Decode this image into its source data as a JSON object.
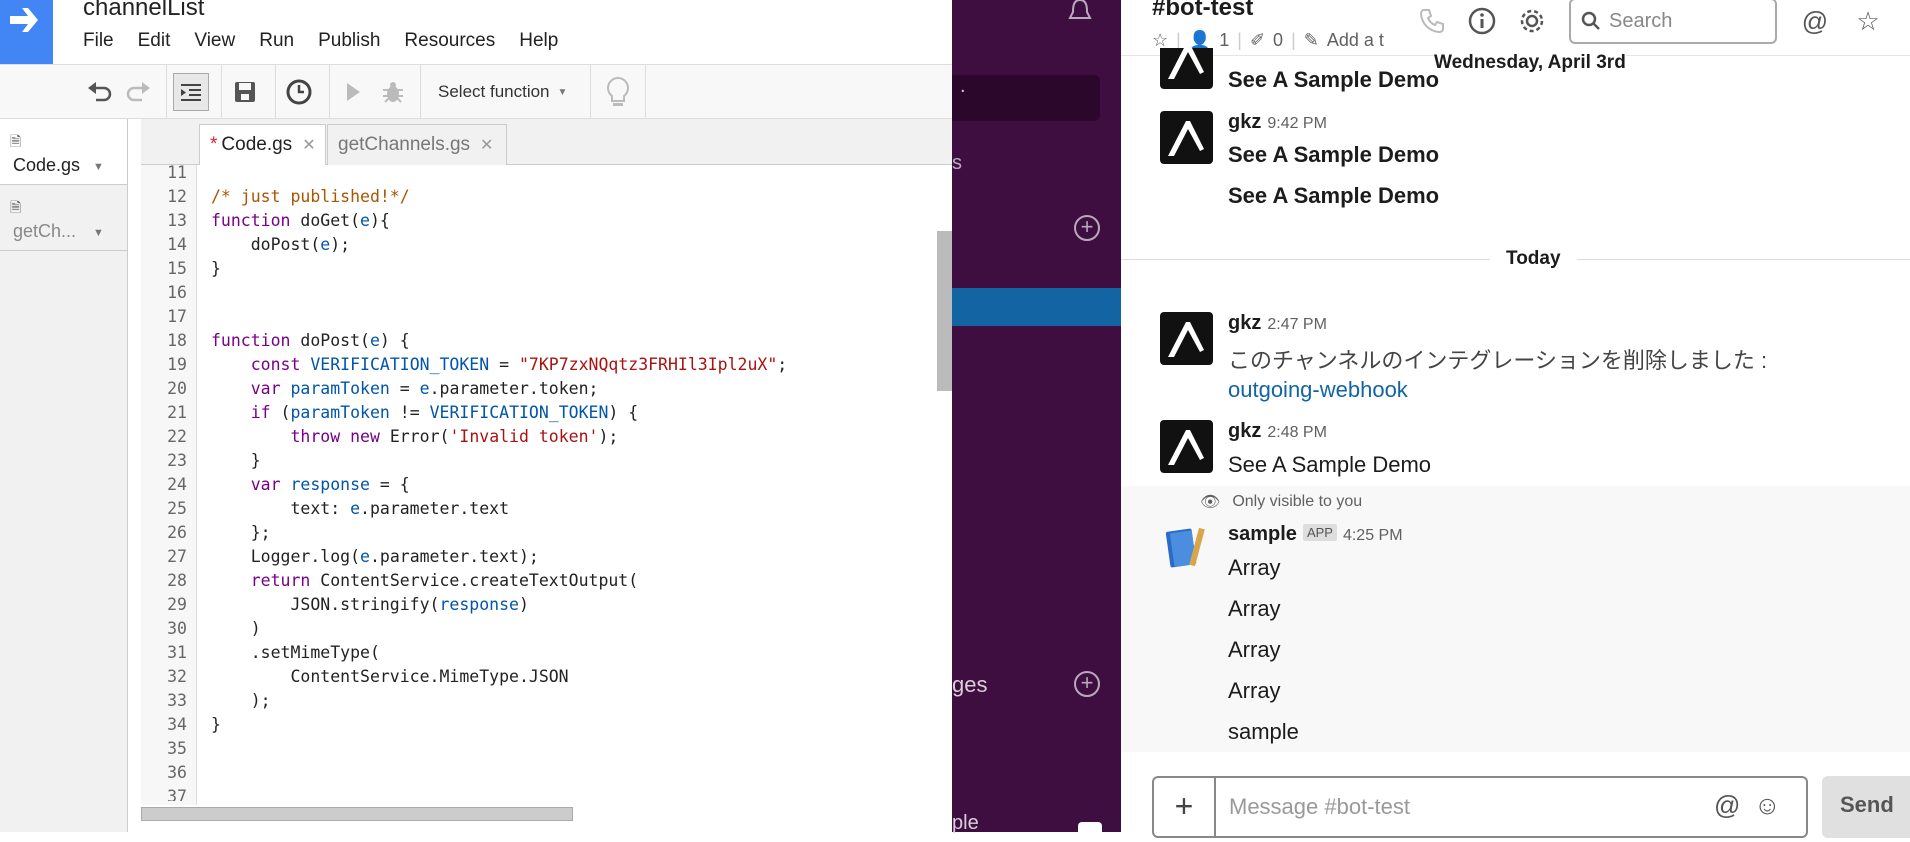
{
  "editor": {
    "project_title": "channelList",
    "menu": [
      "File",
      "Edit",
      "View",
      "Run",
      "Publish",
      "Resources",
      "Help"
    ],
    "select_function": "Select function",
    "files": [
      {
        "name": "Code.gs"
      },
      {
        "name": "getCh..."
      }
    ],
    "tabs": [
      {
        "label": "Code.gs",
        "modified": true
      },
      {
        "label": "getChannels.gs"
      }
    ],
    "line_numbers": [
      "11",
      "12",
      "13",
      "14",
      "15",
      "16",
      "17",
      "18",
      "19",
      "20",
      "21",
      "22",
      "23",
      "24",
      "25",
      "26",
      "27",
      "28",
      "29",
      "30",
      "31",
      "32",
      "33",
      "34",
      "35",
      "36",
      "37"
    ]
  },
  "slack_sidebar": {
    "label_s": "s",
    "label_messages": "ges",
    "label_bottom": "ple"
  },
  "channel": {
    "name": "#bot-test",
    "members": "1",
    "pins": "0",
    "add_topic": "Add a t",
    "search_placeholder": "Search",
    "date_divider": "Wednesday, April 3rd",
    "today_divider": "Today",
    "only_visible": "Only visible to you",
    "composer_placeholder": "Message #bot-test",
    "send_label": "Send"
  },
  "messages": [
    {
      "text": "See A Sample Demo"
    },
    {
      "author": "gkz",
      "time": "9:42 PM",
      "text": "See A Sample Demo"
    },
    {
      "text": "See A Sample Demo"
    },
    {
      "author": "gkz",
      "time": "2:47 PM",
      "text": "このチャンネルのインテグレーションを削除しました :",
      "link": "outgoing-webhook"
    },
    {
      "author": "gkz",
      "time": "2:48 PM",
      "text": "See A Sample Demo"
    },
    {
      "author": "sample",
      "app_badge": "APP",
      "time": "4:25 PM",
      "lines": [
        "Array",
        "Array",
        "Array",
        "Array",
        "sample"
      ]
    }
  ],
  "colors": {
    "apps_script_blue": "#4285f4",
    "slack_sidebar": "#3f0e40",
    "slack_active": "#1264a3",
    "link": "#1264a3"
  }
}
